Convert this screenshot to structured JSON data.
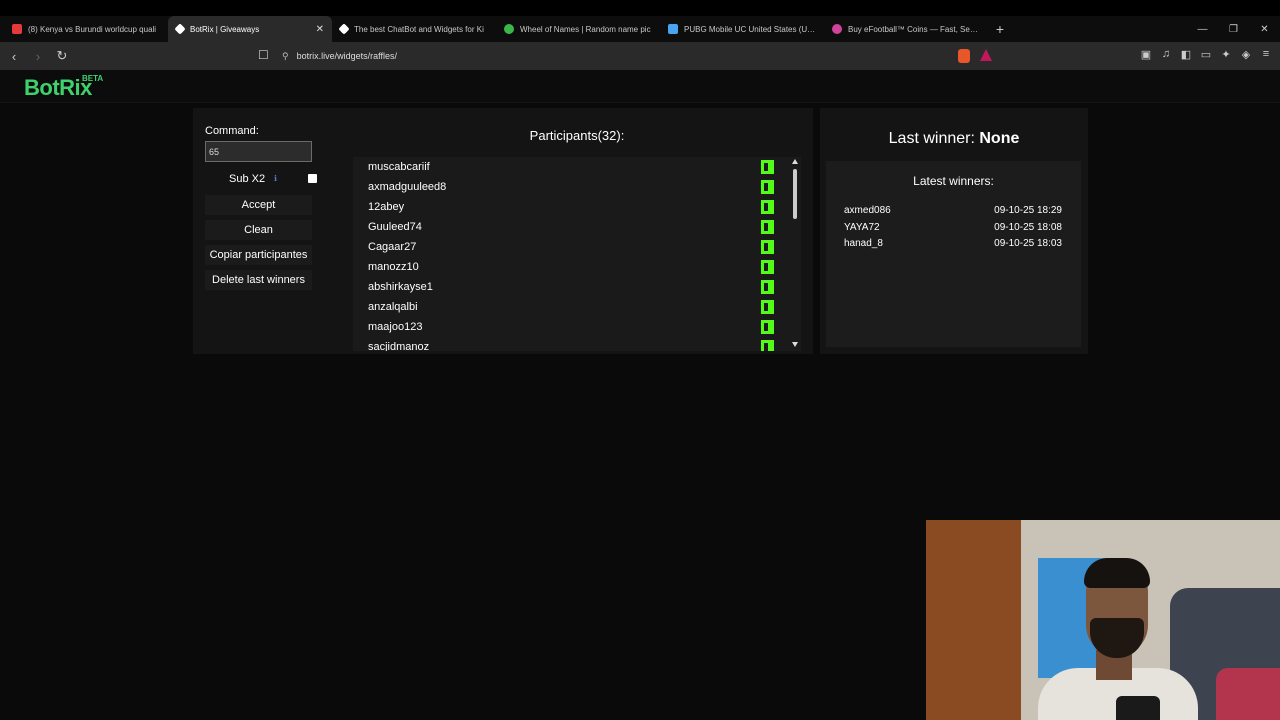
{
  "browser": {
    "tabs": [
      {
        "title": "(8) Kenya vs Burundi worldcup quali",
        "favicon_color": "#e33b3b",
        "active": false
      },
      {
        "title": "BotRix | Giveaways",
        "favicon_color": "#ffffff",
        "active": true
      },
      {
        "title": "The best ChatBot and Widgets for Ki",
        "favicon_color": "#ffffff",
        "active": false
      },
      {
        "title": "Wheel of Names | Random name pic",
        "favicon_color": "#3cb64a",
        "active": false
      },
      {
        "title": "PUBG Mobile UC United States (USA)",
        "favicon_color": "#4aa3f0",
        "active": false
      },
      {
        "title": "Buy eFootball™ Coins — Fast, Secure",
        "favicon_color": "#d0439a",
        "active": false
      }
    ],
    "url": "botrix.live/widgets/raffles/"
  },
  "brand": {
    "logo": "BotRix",
    "badge": "BETA",
    "color": "#3fd16b"
  },
  "controls": {
    "command_label": "Command:",
    "command_value": "65",
    "sub_label": "Sub X2",
    "sub_checked": false,
    "accept_label": "Accept",
    "clean_label": "Clean",
    "copy_label": "Copiar participantes",
    "delete_label": "Delete last winners"
  },
  "participants": {
    "title": "Participants(32):",
    "names": [
      "muscabcariif",
      "axmadguuleed8",
      "12abey",
      "Guuleed74",
      "Cagaar27",
      "manozz10",
      "abshirkayse1",
      "anzalqalbi",
      "maajoo123",
      "sacjidmanoz"
    ]
  },
  "winner": {
    "title": "Last winner: ",
    "value": "None",
    "latest_title": "Latest winners:",
    "latest": [
      {
        "name": "axmed086",
        "time": "09-10-25 18:29"
      },
      {
        "name": "YAYA72",
        "time": "09-10-25 18:08"
      },
      {
        "name": "hanad_8",
        "time": "09-10-25 18:03"
      }
    ]
  }
}
